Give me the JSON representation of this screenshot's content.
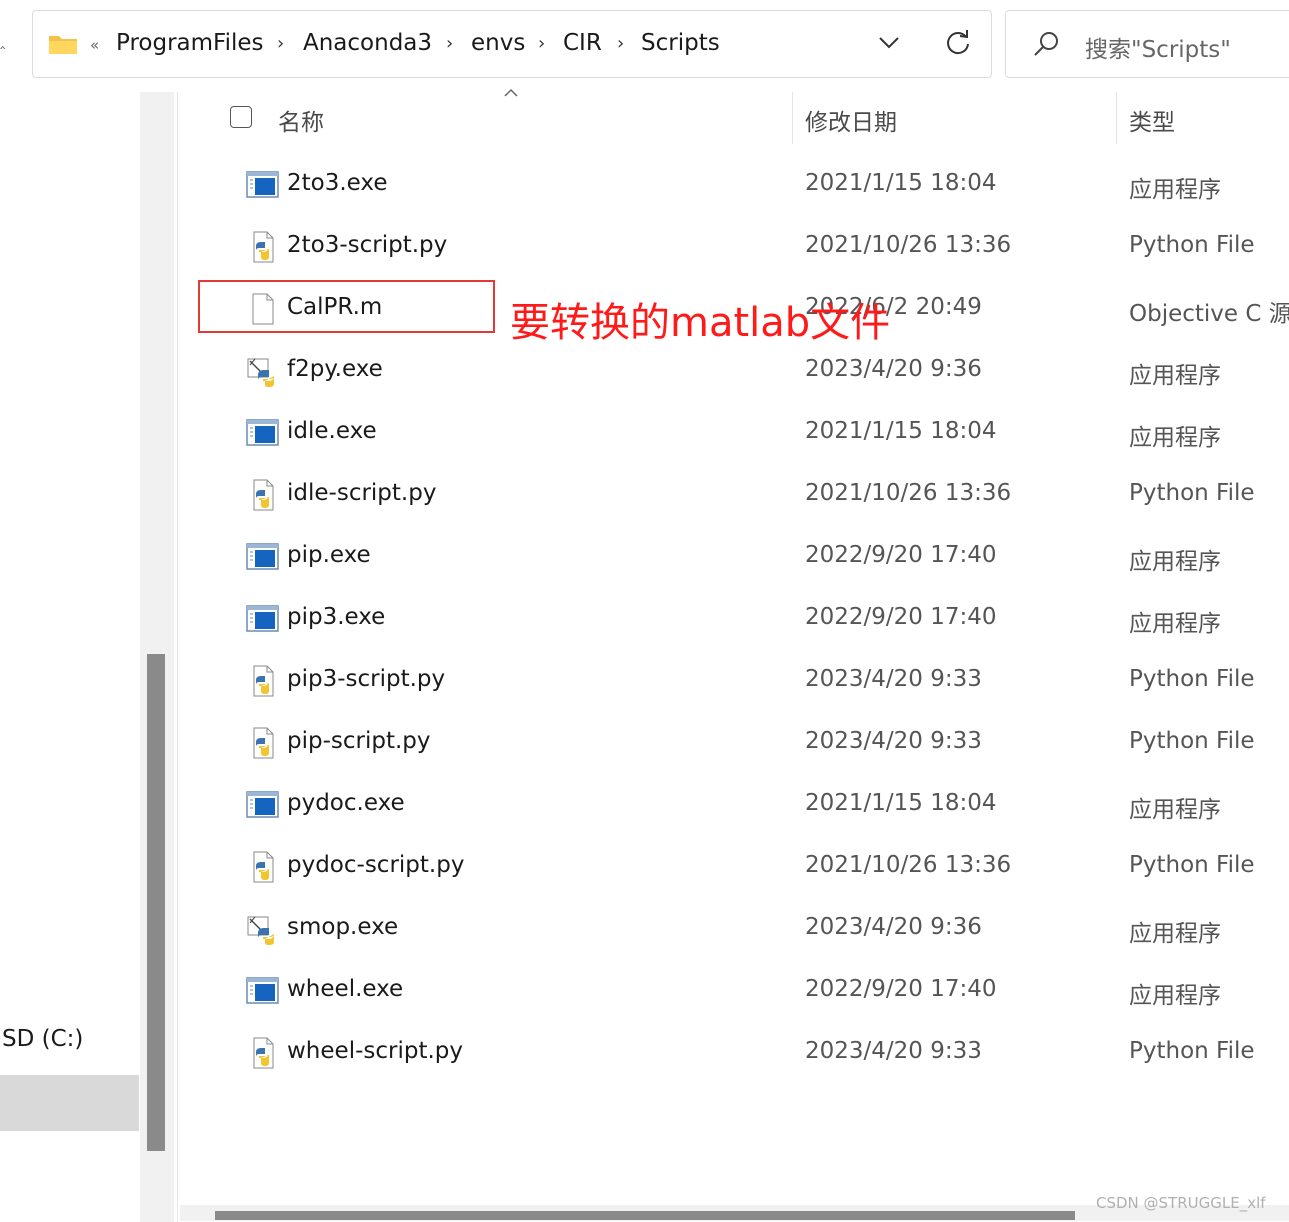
{
  "address": {
    "overflow_marker": "«",
    "crumbs": [
      "ProgramFiles",
      "Anaconda3",
      "envs",
      "CIR",
      "Scripts"
    ]
  },
  "search": {
    "placeholder": "搜索\"Scripts\""
  },
  "nav": {
    "drive_label": "SD (C:)"
  },
  "columns": {
    "name": "名称",
    "date": "修改日期",
    "type": "类型"
  },
  "files": [
    {
      "name": "2to3.exe",
      "date": "2021/1/15 18:04",
      "type": "应用程序",
      "icon": "exe-icon"
    },
    {
      "name": "2to3-script.py",
      "date": "2021/10/26 13:36",
      "type": "Python File",
      "icon": "python-file-icon"
    },
    {
      "name": "CalPR.m",
      "date": "2022/6/2 20:49",
      "type": "Objective C 源",
      "icon": "blank-file-icon"
    },
    {
      "name": "f2py.exe",
      "date": "2023/4/20 9:36",
      "type": "应用程序",
      "icon": "python-exe-icon"
    },
    {
      "name": "idle.exe",
      "date": "2021/1/15 18:04",
      "type": "应用程序",
      "icon": "exe-icon"
    },
    {
      "name": "idle-script.py",
      "date": "2021/10/26 13:36",
      "type": "Python File",
      "icon": "python-file-icon"
    },
    {
      "name": "pip.exe",
      "date": "2022/9/20 17:40",
      "type": "应用程序",
      "icon": "exe-icon"
    },
    {
      "name": "pip3.exe",
      "date": "2022/9/20 17:40",
      "type": "应用程序",
      "icon": "exe-icon"
    },
    {
      "name": "pip3-script.py",
      "date": "2023/4/20 9:33",
      "type": "Python File",
      "icon": "python-file-icon"
    },
    {
      "name": "pip-script.py",
      "date": "2023/4/20 9:33",
      "type": "Python File",
      "icon": "python-file-icon"
    },
    {
      "name": "pydoc.exe",
      "date": "2021/1/15 18:04",
      "type": "应用程序",
      "icon": "exe-icon"
    },
    {
      "name": "pydoc-script.py",
      "date": "2021/10/26 13:36",
      "type": "Python File",
      "icon": "python-file-icon"
    },
    {
      "name": "smop.exe",
      "date": "2023/4/20 9:36",
      "type": "应用程序",
      "icon": "python-exe-icon"
    },
    {
      "name": "wheel.exe",
      "date": "2022/9/20 17:40",
      "type": "应用程序",
      "icon": "exe-icon"
    },
    {
      "name": "wheel-script.py",
      "date": "2023/4/20 9:33",
      "type": "Python File",
      "icon": "python-file-icon"
    }
  ],
  "annotation": {
    "text": "要转换的matlab文件",
    "color": "#ff1a1a"
  },
  "watermark": "CSDN @STRUGGLE_xlf"
}
